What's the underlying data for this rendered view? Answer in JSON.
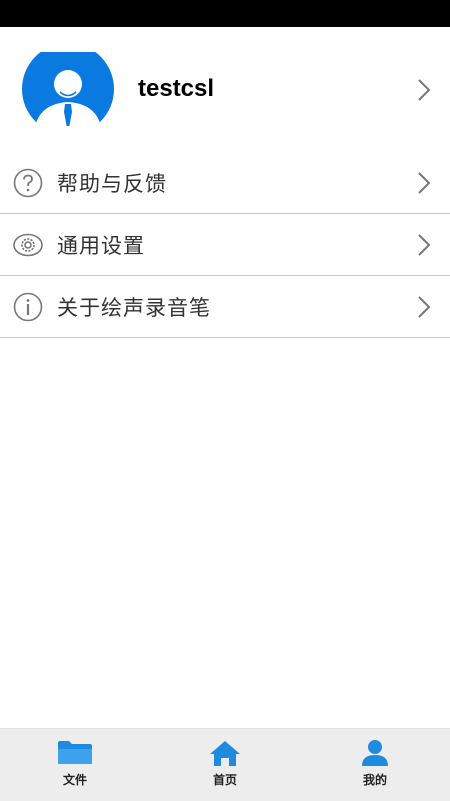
{
  "profile": {
    "username": "testcsl",
    "avatar_icon": "user-avatar-icon"
  },
  "menu": [
    {
      "label": "帮助与反馈",
      "icon": "help-icon"
    },
    {
      "label": "通用设置",
      "icon": "settings-icon"
    },
    {
      "label": "关于绘声录音笔",
      "icon": "info-icon"
    }
  ],
  "tabbar": [
    {
      "label": "文件",
      "icon": "folder-icon",
      "active": false
    },
    {
      "label": "首页",
      "icon": "home-icon",
      "active": false
    },
    {
      "label": "我的",
      "icon": "person-icon",
      "active": true
    }
  ],
  "colors": {
    "accent": "#1e8be0",
    "avatar_bg": "#0a7ae0",
    "text": "#333333",
    "tabbar_bg": "#ededed"
  }
}
